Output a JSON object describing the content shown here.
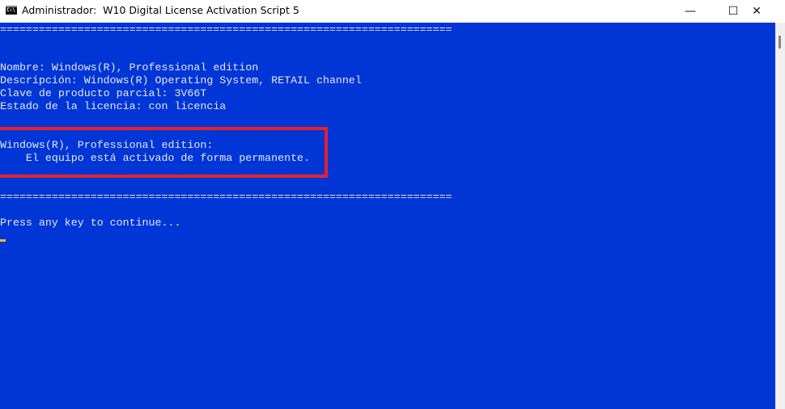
{
  "window": {
    "title": "Administrador:  W10 Digital License Activation Script 5",
    "icon": "console-icon",
    "controls": {
      "minimize": "—",
      "maximize": "☐",
      "close": "✕"
    }
  },
  "console": {
    "separator": "======================================================================",
    "nombre": "Nombre: Windows(R), Professional edition",
    "descripcion": "Descripción: Windows(R) Operating System, RETAIL channel",
    "clave": "Clave de producto parcial: 3V66T",
    "estado": "Estado de la licencia: con licencia",
    "edition": "Windows(R), Professional edition:",
    "activated": "    El equipo está activado de forma permanente.",
    "prompt": "Press any key to continue..."
  },
  "colors": {
    "background": "#0035d6",
    "highlight": "#e8202a",
    "cursor": "#f5c020"
  }
}
